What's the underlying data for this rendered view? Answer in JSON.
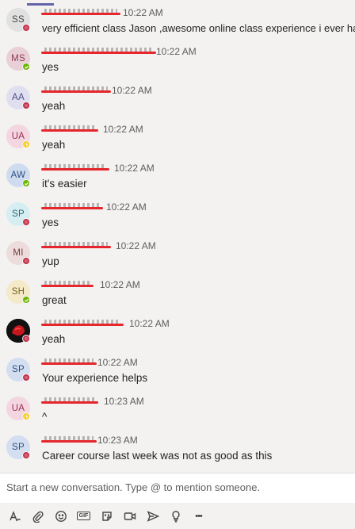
{
  "messages": [
    {
      "initials": "SS",
      "avatar_bg": "#e1e1e1",
      "avatar_fg": "#444",
      "status": "busy",
      "time": "10:22 AM",
      "text": "very efficient class Jason ,awesome online class experience i ever had."
    },
    {
      "initials": "MS",
      "avatar_bg": "#e9d0d6",
      "avatar_fg": "#8b3a52",
      "status": "available",
      "time": "10:22 AM",
      "text": "yes"
    },
    {
      "initials": "AA",
      "avatar_bg": "#dfdff0",
      "avatar_fg": "#4d4d8a",
      "status": "busy",
      "time": "10:22 AM",
      "text": "yeah"
    },
    {
      "initials": "UA",
      "avatar_bg": "#f3d6e0",
      "avatar_fg": "#9a2e5a",
      "status": "away",
      "time": "10:22 AM",
      "text": "yeah"
    },
    {
      "initials": "AW",
      "avatar_bg": "#cfdcef",
      "avatar_fg": "#2d4f82",
      "status": "available",
      "time": "10:22 AM",
      "text": "it's easier"
    },
    {
      "initials": "SP",
      "avatar_bg": "#d6eef2",
      "avatar_fg": "#2b6b78",
      "status": "busy",
      "time": "10:22 AM",
      "text": "yes"
    },
    {
      "initials": "MI",
      "avatar_bg": "#ecdcdc",
      "avatar_fg": "#7a3b3b",
      "status": "busy",
      "time": "10:22 AM",
      "text": " yup"
    },
    {
      "initials": "SH",
      "avatar_bg": "#f4e9c8",
      "avatar_fg": "#7b6320",
      "status": "available",
      "time": "10:22 AM",
      "text": "great"
    },
    {
      "initials": "",
      "avatar_bg": "#111111",
      "avatar_fg": "#fff",
      "status": "busy",
      "time": "10:22 AM",
      "text": "yeah",
      "photo": true
    },
    {
      "initials": "SP",
      "avatar_bg": "#d3dff0",
      "avatar_fg": "#2d4f82",
      "status": "busy",
      "time": "10:22 AM",
      "text": "Your experience helps"
    },
    {
      "initials": "UA",
      "avatar_bg": "#f3d6e0",
      "avatar_fg": "#9a2e5a",
      "status": "away",
      "time": "10:23 AM",
      "text": "^"
    },
    {
      "initials": "SP",
      "avatar_bg": "#d3dff0",
      "avatar_fg": "#2d4f82",
      "status": "busy",
      "time": "10:23 AM",
      "text": "Career course last week was not as good as this"
    }
  ],
  "composer": {
    "placeholder": "Start a new conversation. Type @ to mention someone."
  },
  "toolbar": {
    "icons": [
      "format-icon",
      "attach-icon",
      "emoji-icon",
      "gif-icon",
      "sticker-icon",
      "meet-icon",
      "send-icon",
      "praise-icon",
      "more-icon"
    ],
    "gif_label": "GIF",
    "more_label": "•••"
  },
  "colors": {
    "busy": "#c4314b",
    "available": "#6bb700",
    "away": "#f8d22a",
    "redaction": "#e5262c"
  }
}
